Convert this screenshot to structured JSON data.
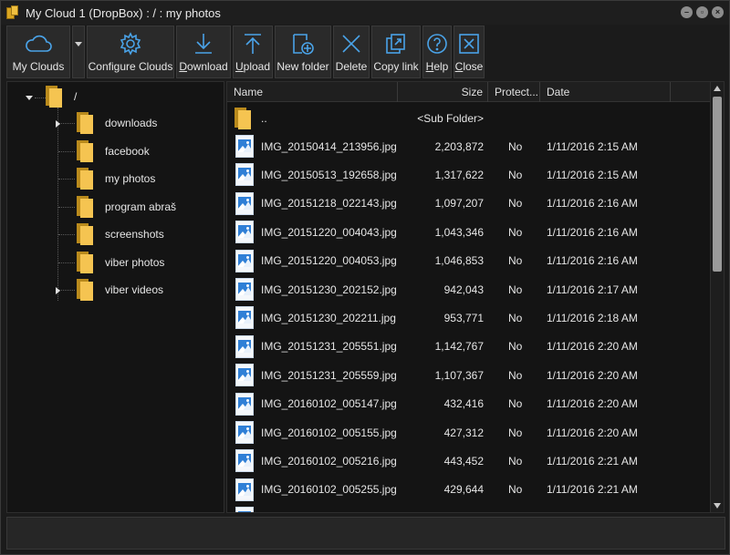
{
  "window": {
    "title": "My Cloud 1 (DropBox) : / : my photos",
    "controls": [
      "minimize",
      "maximize",
      "close"
    ]
  },
  "toolbar": {
    "buttons": [
      {
        "label": "My Clouds",
        "icon": "cloud-icon"
      },
      {
        "label": "Configure Clouds",
        "icon": "gear-icon"
      },
      {
        "label": "Download",
        "accel": "D",
        "rest": "ownload",
        "icon": "download-icon"
      },
      {
        "label": "Upload",
        "accel": "U",
        "rest": "pload",
        "icon": "upload-icon"
      },
      {
        "label": "New folder",
        "icon": "new-folder-icon"
      },
      {
        "label": "Delete",
        "icon": "delete-icon"
      },
      {
        "label": "Copy link",
        "icon": "copy-link-icon"
      },
      {
        "label": "Help",
        "accel": "H",
        "rest": "elp",
        "icon": "help-icon"
      },
      {
        "label": "Close",
        "accel": "C",
        "rest": "lose",
        "icon": "close-icon"
      }
    ]
  },
  "tree": {
    "root": "/",
    "children": [
      {
        "name": "downloads",
        "expandable": true
      },
      {
        "name": "facebook",
        "expandable": false
      },
      {
        "name": "my photos",
        "expandable": false
      },
      {
        "name": "program abraš",
        "expandable": false
      },
      {
        "name": "screenshots",
        "expandable": false
      },
      {
        "name": "viber photos",
        "expandable": false
      },
      {
        "name": "viber videos",
        "expandable": true
      }
    ]
  },
  "list": {
    "columns": {
      "name": "Name",
      "size": "Size",
      "protected": "Protect...",
      "date": "Date"
    },
    "parent": {
      "name": "..",
      "size": "<Sub Folder>"
    },
    "files": [
      {
        "name": "IMG_20150414_213956.jpg",
        "size": "2,203,872",
        "protected": "No",
        "date": "1/11/2016 2:15 AM"
      },
      {
        "name": "IMG_20150513_192658.jpg",
        "size": "1,317,622",
        "protected": "No",
        "date": "1/11/2016 2:15 AM"
      },
      {
        "name": "IMG_20151218_022143.jpg",
        "size": "1,097,207",
        "protected": "No",
        "date": "1/11/2016 2:16 AM"
      },
      {
        "name": "IMG_20151220_004043.jpg",
        "size": "1,043,346",
        "protected": "No",
        "date": "1/11/2016 2:16 AM"
      },
      {
        "name": "IMG_20151220_004053.jpg",
        "size": "1,046,853",
        "protected": "No",
        "date": "1/11/2016 2:16 AM"
      },
      {
        "name": "IMG_20151230_202152.jpg",
        "size": "942,043",
        "protected": "No",
        "date": "1/11/2016 2:17 AM"
      },
      {
        "name": "IMG_20151230_202211.jpg",
        "size": "953,771",
        "protected": "No",
        "date": "1/11/2016 2:18 AM"
      },
      {
        "name": "IMG_20151231_205551.jpg",
        "size": "1,142,767",
        "protected": "No",
        "date": "1/11/2016 2:20 AM"
      },
      {
        "name": "IMG_20151231_205559.jpg",
        "size": "1,107,367",
        "protected": "No",
        "date": "1/11/2016 2:20 AM"
      },
      {
        "name": "IMG_20160102_005147.jpg",
        "size": "432,416",
        "protected": "No",
        "date": "1/11/2016 2:20 AM"
      },
      {
        "name": "IMG_20160102_005155.jpg",
        "size": "427,312",
        "protected": "No",
        "date": "1/11/2016 2:20 AM"
      },
      {
        "name": "IMG_20160102_005216.jpg",
        "size": "443,452",
        "protected": "No",
        "date": "1/11/2016 2:21 AM"
      },
      {
        "name": "IMG_20160102_005255.jpg",
        "size": "429,644",
        "protected": "No",
        "date": "1/11/2016 2:21 AM"
      }
    ]
  },
  "colors": {
    "background": "#1b1b1b",
    "panel": "#141414",
    "toolbar_button": "#2a2a2a",
    "accent_blue": "#4aa3e8",
    "folder": "#f5c451"
  }
}
